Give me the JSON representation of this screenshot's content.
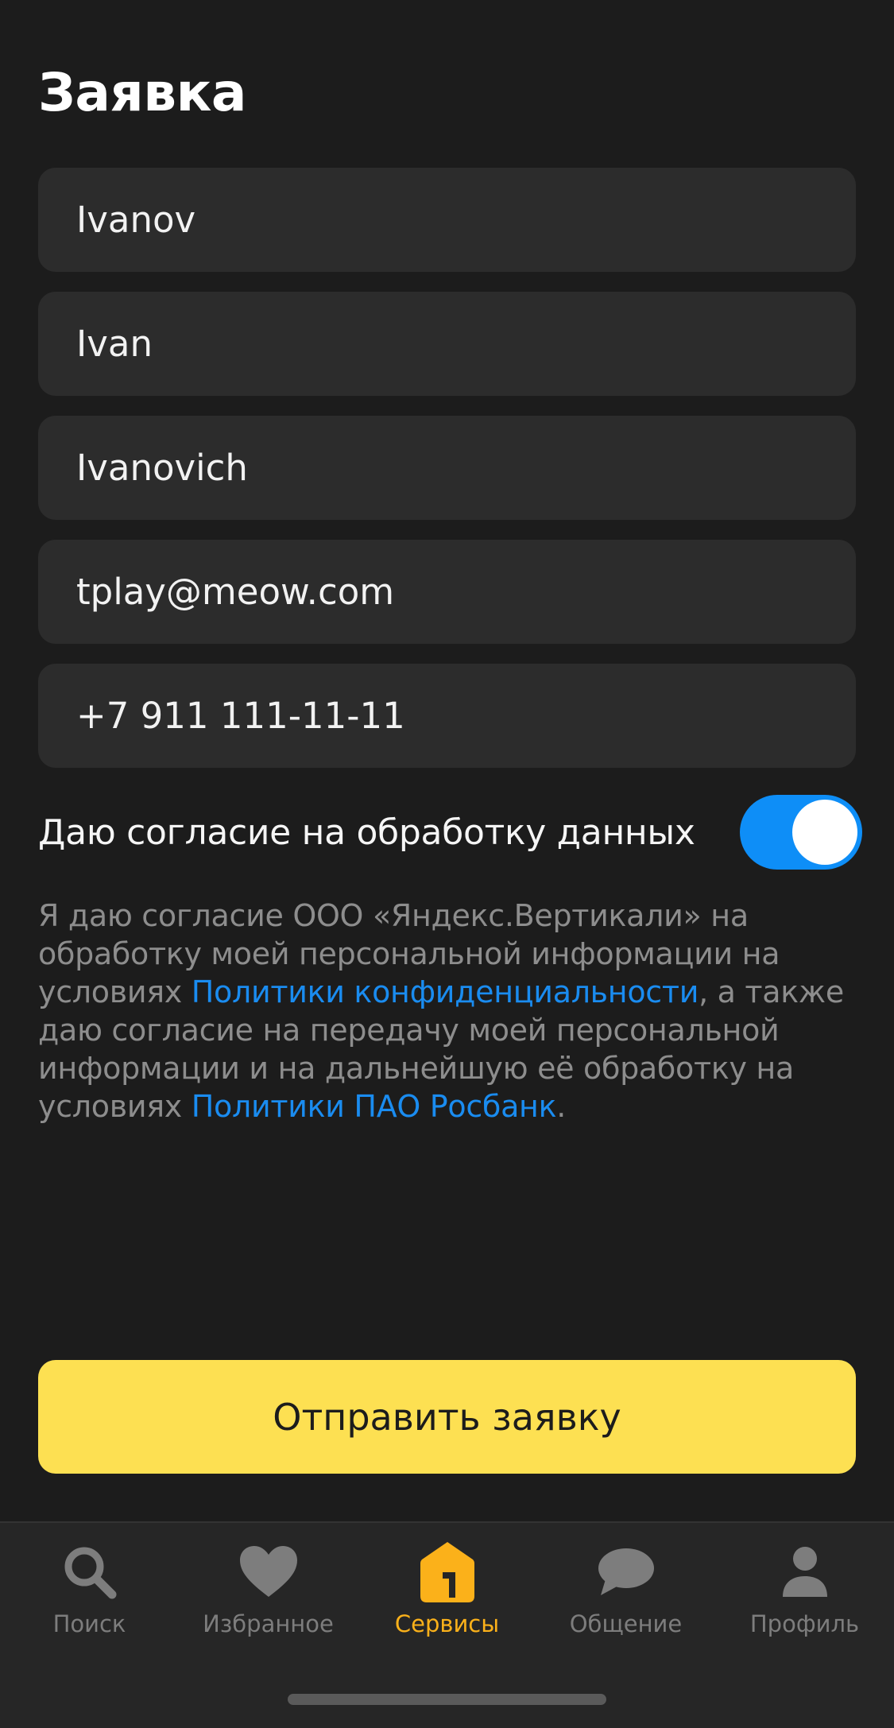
{
  "page": {
    "title": "Заявка"
  },
  "form": {
    "fields": [
      {
        "value": "Ivanov"
      },
      {
        "value": "Ivan"
      },
      {
        "value": "Ivanovich"
      },
      {
        "value": "tplay@meow.com"
      },
      {
        "value": "+7 911 111-11-11"
      }
    ],
    "consent": {
      "label": "Даю согласие на обработку данных",
      "enabled": true,
      "accent": "#0e8ef7"
    },
    "legal": {
      "part1": "Я даю согласие ООО «Яндекс.Вертикали» на обработку моей персональной информации на условиях ",
      "link1": "Политики конфиденциальности",
      "part2": ", а также даю согласие на передачу моей персональной информации и на дальнейшую её обработку на условиях ",
      "link2": "Политики ПАО Росбанк",
      "part3": "."
    },
    "submit_label": "Отправить заявку"
  },
  "tabbar": {
    "items": [
      {
        "label": "Поиск",
        "icon": "search-icon",
        "active": false
      },
      {
        "label": "Избранное",
        "icon": "heart-icon",
        "active": false
      },
      {
        "label": "Сервисы",
        "icon": "services-icon",
        "active": true
      },
      {
        "label": "Общение",
        "icon": "chat-bubble-icon",
        "active": false
      },
      {
        "label": "Профиль",
        "icon": "profile-icon",
        "active": false
      }
    ],
    "active_color": "#fbb11a",
    "inactive_color": "#7d7d7d"
  },
  "colors": {
    "submit_bg": "#fde052",
    "link": "#1a8cf0",
    "background": "#1c1c1c"
  }
}
